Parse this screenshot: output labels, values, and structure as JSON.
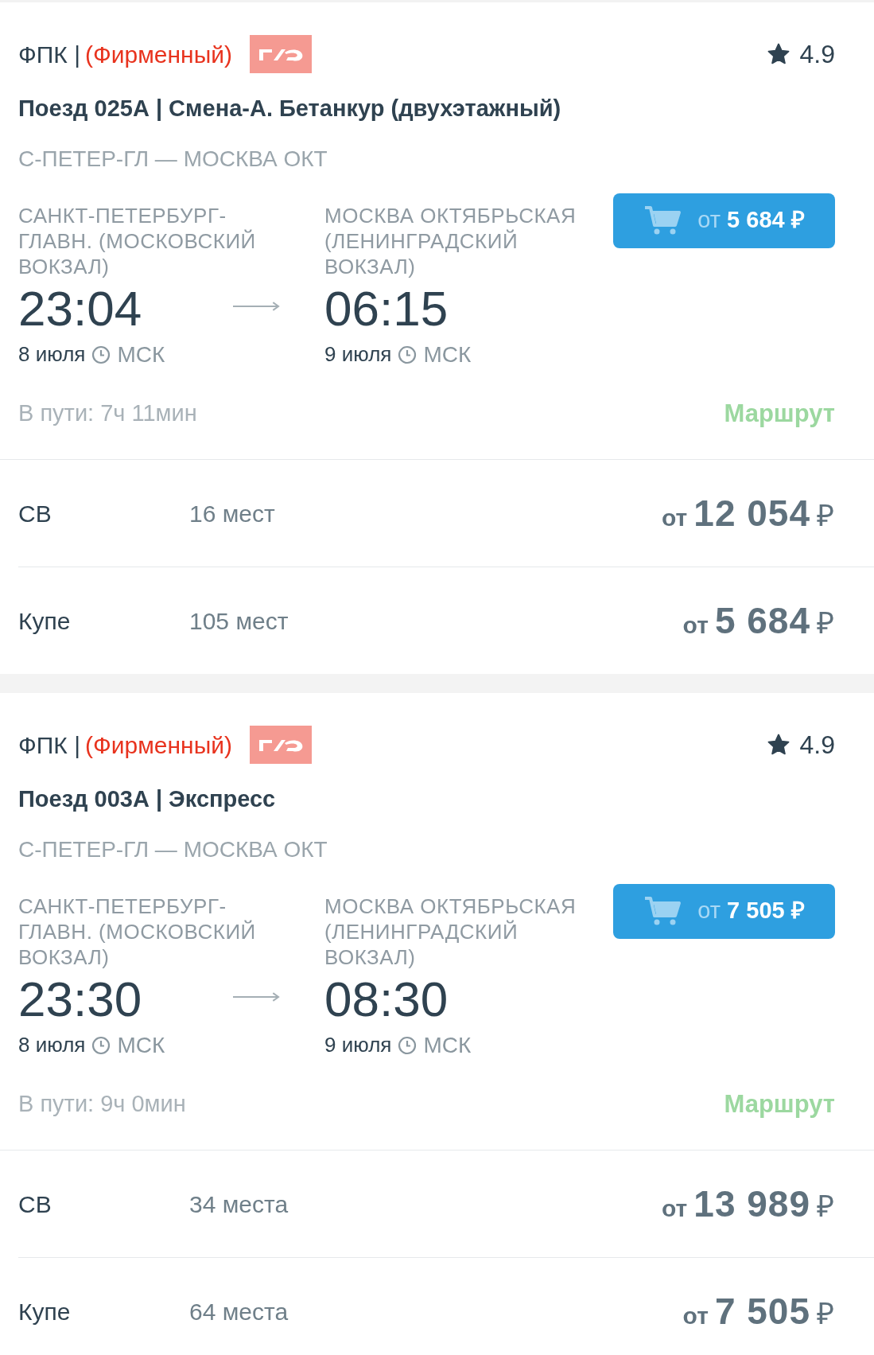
{
  "trains": [
    {
      "carrier": "ФПК |",
      "category": "(Фирменный)",
      "rating": "4.9",
      "title": "Поезд 025А | Смена-А. Бетанкур (двухэтажный)",
      "route": "С-ПЕТЕР-ГЛ — МОСКВА ОКТ",
      "departure": {
        "station": "САНКТ-ПЕТЕРБУРГ-ГЛАВН. (МОСКОВСКИЙ ВОКЗАЛ)",
        "time": "23:04",
        "date": "8 июля",
        "zone": "МСК"
      },
      "arrival": {
        "station": "МОСКВА ОКТЯБРЬСКАЯ (ЛЕНИНГРАДСКИЙ ВОКЗАЛ)",
        "time": "06:15",
        "date": "9 июля",
        "zone": "МСК"
      },
      "buy": {
        "prefix": "от",
        "price": "5 684 ₽"
      },
      "duration": "В пути: 7ч 11мин",
      "route_link": "Маршрут",
      "classes": [
        {
          "name": "СВ",
          "seats": "16 мест",
          "prefix": "от",
          "price": "12 054",
          "currency": "₽"
        },
        {
          "name": "Купе",
          "seats": "105 мест",
          "prefix": "от",
          "price": "5 684",
          "currency": "₽"
        }
      ]
    },
    {
      "carrier": "ФПК |",
      "category": "(Фирменный)",
      "rating": "4.9",
      "title": "Поезд 003А | Экспресс",
      "route": "С-ПЕТЕР-ГЛ — МОСКВА ОКТ",
      "departure": {
        "station": "САНКТ-ПЕТЕРБУРГ-ГЛАВН. (МОСКОВСКИЙ ВОКЗАЛ)",
        "time": "23:30",
        "date": "8 июля",
        "zone": "МСК"
      },
      "arrival": {
        "station": "МОСКВА ОКТЯБРЬСКАЯ (ЛЕНИНГРАДСКИЙ ВОКЗАЛ)",
        "time": "08:30",
        "date": "9 июля",
        "zone": "МСК"
      },
      "buy": {
        "prefix": "от",
        "price": "7 505 ₽"
      },
      "duration": "В пути: 9ч 0мин",
      "route_link": "Маршрут",
      "classes": [
        {
          "name": "СВ",
          "seats": "34 места",
          "prefix": "от",
          "price": "13 989",
          "currency": "₽"
        },
        {
          "name": "Купе",
          "seats": "64 места",
          "prefix": "от",
          "price": "7 505",
          "currency": "₽"
        }
      ]
    }
  ]
}
